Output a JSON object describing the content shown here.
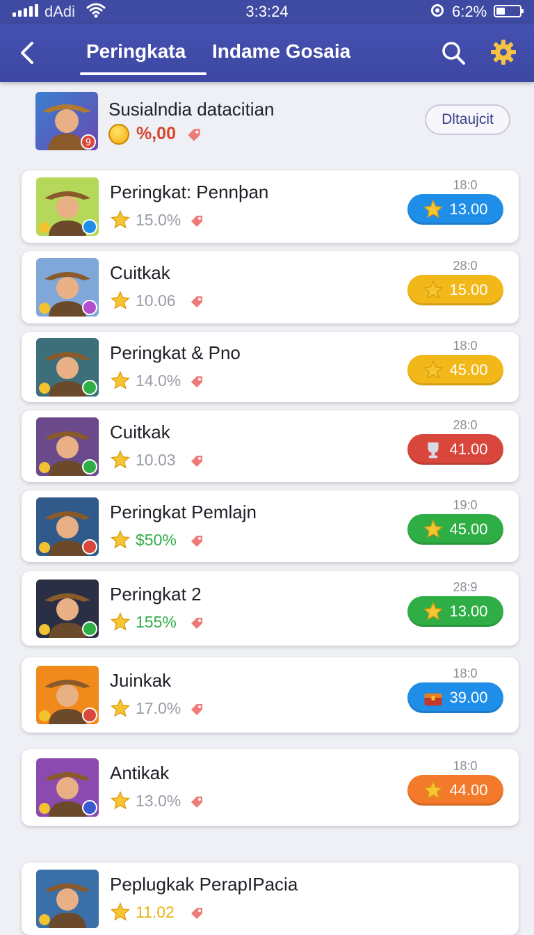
{
  "status_bar": {
    "carrier": "dAdi",
    "time": "3:3:24",
    "battery": "6:2%",
    "icons": [
      "signal-icon",
      "wifi-icon",
      "record-icon",
      "battery-icon"
    ]
  },
  "app_bar": {
    "back_icon": "back-arrow-icon",
    "tabs": [
      {
        "label": "Peringkata",
        "active": true
      },
      {
        "label": "Indame Gosaia",
        "active": false
      }
    ],
    "search_icon": "search-icon",
    "settings_icon": "gear-icon"
  },
  "featured": {
    "name": "Susialndia datacitian",
    "amount": "%,00",
    "button_label": "Dltaujcit"
  },
  "colors": {
    "header": "#4048a6",
    "blue": "#1f8ee8",
    "yellow": "#f2b81a",
    "red": "#d9463b",
    "green": "#2fae46",
    "orange": "#f27a2a"
  },
  "items": [
    {
      "name": "Peringkat: Pennþan",
      "percent": "15.0%",
      "count": "18:0",
      "price": "13.00",
      "pill_color": "blue",
      "pill_icon": "star-icon",
      "badge_color": "#1f8ee8",
      "badge": "c",
      "avatar_bg": "#b5d85a"
    },
    {
      "name": "Cuitkak",
      "percent": "10.06",
      "count": "28:0",
      "price": "15.00",
      "pill_color": "yellow",
      "pill_icon": "star-icon",
      "badge_color": "#b04fd0",
      "badge": "",
      "avatar_bg": "#7fa8d8"
    },
    {
      "name": "Peringkat & Pno",
      "percent": "14.0%",
      "count": "18:0",
      "price": "45.00",
      "pill_color": "yellow",
      "pill_icon": "star-icon",
      "badge_color": "#2fae46",
      "badge": "9",
      "avatar_bg": "#3d6f7a"
    },
    {
      "name": "Cuitkak",
      "percent": "10.03",
      "count": "28:0",
      "price": "41.00",
      "pill_color": "red",
      "pill_icon": "cup-icon",
      "badge_color": "#2fae46",
      "badge": "6",
      "avatar_bg": "#6a4a8a"
    },
    {
      "name": "Peringkat Pemlajn",
      "percent": "$50%",
      "count": "19:0",
      "price": "45.00",
      "pill_color": "green",
      "pill_icon": "star-icon",
      "badge_color": "#d9463b",
      "badge": "0",
      "avatar_bg": "#2f5a8a"
    },
    {
      "name": "Peringkat 2",
      "percent": "155%",
      "count": "28:9",
      "price": "13.00",
      "pill_color": "green",
      "pill_icon": "star-icon",
      "badge_color": "#2fae46",
      "badge": "9",
      "avatar_bg": "#2b2f45"
    },
    {
      "name": "Juinkak",
      "percent": "17.0%",
      "count": "18:0",
      "price": "39.00",
      "pill_color": "blue",
      "pill_icon": "chest-icon",
      "badge_color": "#d9463b",
      "badge": "Q",
      "avatar_bg": "#f08a1a"
    },
    {
      "name": "Antikak",
      "percent": "13.0%",
      "count": "18:0",
      "price": "44.00",
      "pill_color": "orange",
      "pill_icon": "star-icon",
      "badge_color": "#3a5ad0",
      "badge": "0",
      "avatar_bg": "#8a4ab0"
    },
    {
      "name": "Peplugkak PerapIPacia",
      "percent": "11.02",
      "count": "",
      "price": "",
      "pill_color": "",
      "pill_icon": "",
      "badge_color": "",
      "badge": "",
      "avatar_bg": "#3a6fa8"
    }
  ]
}
